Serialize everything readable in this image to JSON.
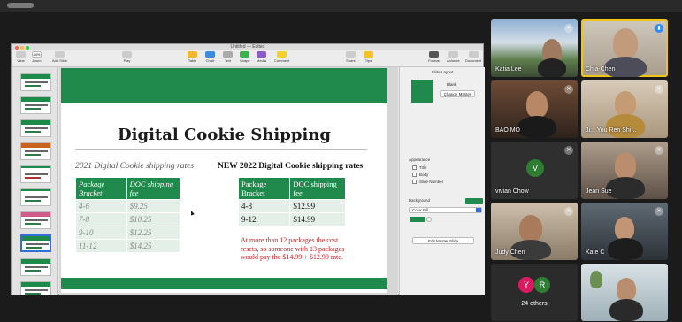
{
  "keynote": {
    "window_title": "Untitled — Edited",
    "toolbar": [
      {
        "label": "View"
      },
      {
        "label": "Zoom"
      },
      {
        "label": "Add Slide"
      },
      {
        "label": "Play"
      },
      {
        "label": "Table"
      },
      {
        "label": "Chart"
      },
      {
        "label": "Text"
      },
      {
        "label": "Shape"
      },
      {
        "label": "Media"
      },
      {
        "label": "Comment"
      },
      {
        "label": "Share"
      },
      {
        "label": "Tips"
      },
      {
        "label": "Format"
      },
      {
        "label": "Animate"
      },
      {
        "label": "Document"
      }
    ],
    "zoom_value": "84%"
  },
  "slide": {
    "title": "Digital Cookie Shipping",
    "left_subtitle": "2021 Digital Cookie shipping rates",
    "right_subtitle": "NEW 2022 Digital Cookie shipping rates",
    "old_table": {
      "headers": [
        "Package Bracket",
        "DOC shipping fee"
      ],
      "rows": [
        [
          "4-6",
          "$9.25"
        ],
        [
          "7-8",
          "$10.25"
        ],
        [
          "9-10",
          "$12.25"
        ],
        [
          "11-12",
          "$14.25"
        ]
      ]
    },
    "new_table": {
      "headers": [
        "Package Bracket",
        "DOC shipping fee"
      ],
      "rows": [
        [
          "4-8",
          "$12.99"
        ],
        [
          "9-12",
          "$14.99"
        ]
      ]
    },
    "note": "At more than 12 packages the cost resets, so someone with 13 packages would pay the $14.99 + $12.99 rate."
  },
  "inspector": {
    "header": "Slide Layout",
    "master_name": "Blank",
    "change_master": "Change Master",
    "appearance": "Appearance",
    "checkboxes": [
      "Title",
      "Body",
      "Slide Number"
    ],
    "background": "Background",
    "fill_type": "Color Fill",
    "edit_master": "Edit Master Slide"
  },
  "participants": [
    {
      "name": "Katia Lee",
      "muted": true
    },
    {
      "name": "Chia-Chen",
      "speaking": true
    },
    {
      "name": "BAO MO",
      "muted": true
    },
    {
      "name": "Ji... You Ren Shi...",
      "muted": true
    },
    {
      "name": "vivian Chow",
      "initial": "V",
      "muted": true
    },
    {
      "name": "Jean Sue",
      "muted": true
    },
    {
      "name": "Judy Chen",
      "muted": true
    },
    {
      "name": "Kate C",
      "muted": true
    },
    {
      "name": "24 others",
      "initials": [
        "Y",
        "R"
      ]
    },
    {
      "name": ""
    }
  ],
  "colors": {
    "accent_green": "#1f8a4c",
    "note_red": "#c81c1c",
    "zoom_blue": "#2d8cff"
  }
}
